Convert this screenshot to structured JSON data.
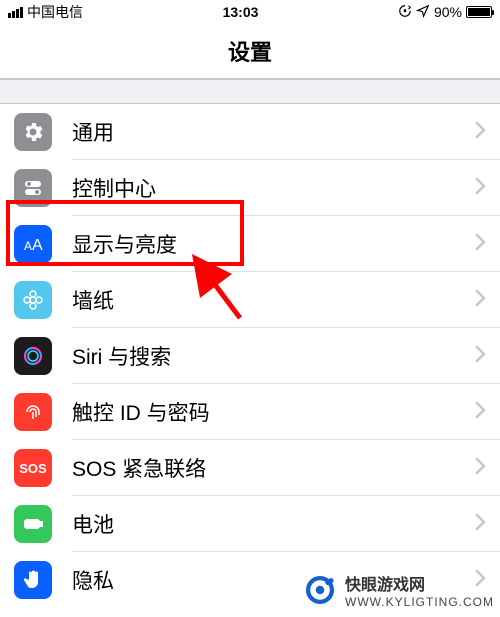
{
  "status": {
    "carrier": "中国电信",
    "time": "13:03",
    "battery_pct": "90%"
  },
  "nav": {
    "title": "设置"
  },
  "rows": [
    {
      "key": "general",
      "label": "通用",
      "bg": "#8e8e93"
    },
    {
      "key": "control",
      "label": "控制中心",
      "bg": "#8e8e93"
    },
    {
      "key": "display",
      "label": "显示与亮度",
      "bg": "#0a60ff"
    },
    {
      "key": "wallpaper",
      "label": "墙纸",
      "bg": "#54c7ec"
    },
    {
      "key": "siri",
      "label": "Siri 与搜索",
      "bg": "#1c1c1e"
    },
    {
      "key": "touchid",
      "label": "触控 ID 与密码",
      "bg": "#ff3b30"
    },
    {
      "key": "sos",
      "label": "SOS 紧急联络",
      "bg": "#ff3b30",
      "text_icon": "SOS"
    },
    {
      "key": "battery",
      "label": "电池",
      "bg": "#34c759"
    },
    {
      "key": "privacy",
      "label": "隐私",
      "bg": "#0a60ff"
    }
  ],
  "watermark": {
    "title": "快眼游戏网",
    "url": "WWW.KYLIGTING.COM"
  }
}
